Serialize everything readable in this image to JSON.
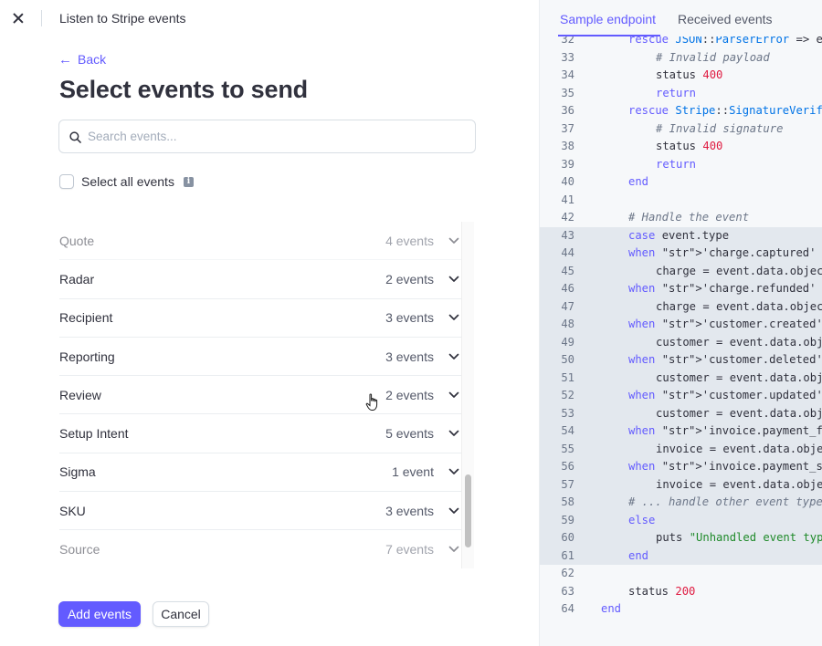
{
  "window": {
    "title": "Listen to Stripe events"
  },
  "nav": {
    "back_label": "Back"
  },
  "page": {
    "title": "Select events to send"
  },
  "search": {
    "placeholder": "Search events..."
  },
  "select_all": {
    "label": "Select all events",
    "info_icon": "info-icon"
  },
  "events": [
    {
      "name": "Quote",
      "count": "4 events"
    },
    {
      "name": "Radar",
      "count": "2 events"
    },
    {
      "name": "Recipient",
      "count": "3 events"
    },
    {
      "name": "Reporting",
      "count": "3 events"
    },
    {
      "name": "Review",
      "count": "2 events"
    },
    {
      "name": "Setup Intent",
      "count": "5 events"
    },
    {
      "name": "Sigma",
      "count": "1 event"
    },
    {
      "name": "SKU",
      "count": "3 events"
    },
    {
      "name": "Source",
      "count": "7 events"
    }
  ],
  "footer": {
    "primary_label": "Add events",
    "secondary_label": "Cancel"
  },
  "tabs": [
    {
      "label": "Sample endpoint"
    },
    {
      "label": "Received events"
    }
  ],
  "code": {
    "lines": [
      {
        "n": "32",
        "text": "rescue JSON::ParserError => e"
      },
      {
        "n": "33",
        "text": "# Invalid payload"
      },
      {
        "n": "34",
        "text": "status 400"
      },
      {
        "n": "35",
        "text": "return"
      },
      {
        "n": "36",
        "text": "rescue Stripe::SignatureVerificationError => e"
      },
      {
        "n": "37",
        "text": "# Invalid signature"
      },
      {
        "n": "38",
        "text": "status 400"
      },
      {
        "n": "39",
        "text": "return"
      },
      {
        "n": "40",
        "text": "end"
      },
      {
        "n": "41",
        "text": ""
      },
      {
        "n": "42",
        "text": "# Handle the event"
      },
      {
        "n": "43",
        "text": "case event.type"
      },
      {
        "n": "44",
        "text": "when 'charge.captured'"
      },
      {
        "n": "45",
        "text": "charge = event.data.object"
      },
      {
        "n": "46",
        "text": "when 'charge.refunded'"
      },
      {
        "n": "47",
        "text": "charge = event.data.object"
      },
      {
        "n": "48",
        "text": "when 'customer.created'"
      },
      {
        "n": "49",
        "text": "customer = event.data.object"
      },
      {
        "n": "50",
        "text": "when 'customer.deleted'"
      },
      {
        "n": "51",
        "text": "customer = event.data.object"
      },
      {
        "n": "52",
        "text": "when 'customer.updated'"
      },
      {
        "n": "53",
        "text": "customer = event.data.object"
      },
      {
        "n": "54",
        "text": "when 'invoice.payment_failed'"
      },
      {
        "n": "55",
        "text": "invoice = event.data.object"
      },
      {
        "n": "56",
        "text": "when 'invoice.payment_succeeded'"
      },
      {
        "n": "57",
        "text": "invoice = event.data.object"
      },
      {
        "n": "58",
        "text": "# ... handle other event types"
      },
      {
        "n": "59",
        "text": "else"
      },
      {
        "n": "60",
        "text": "puts \"Unhandled event type: #{event.type}\""
      },
      {
        "n": "61",
        "text": "end"
      },
      {
        "n": "62",
        "text": ""
      },
      {
        "n": "63",
        "text": "status 200"
      },
      {
        "n": "64",
        "text": "end"
      }
    ]
  },
  "colors": {
    "accent": "#635bff",
    "text": "#30313d",
    "muted": "#545969",
    "code_string": "#1f8a2a",
    "code_number": "#df1b41",
    "code_highlight": "#e3e8ee"
  }
}
